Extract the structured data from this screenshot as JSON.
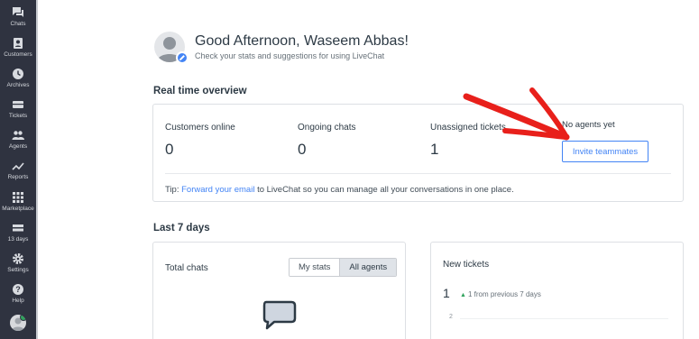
{
  "sidebar": {
    "items": [
      {
        "label": "Chats",
        "icon": "chat-icon"
      },
      {
        "label": "Customers",
        "icon": "customers-icon"
      },
      {
        "label": "Archives",
        "icon": "archives-icon"
      },
      {
        "label": "Tickets",
        "icon": "tickets-icon"
      },
      {
        "label": "Agents",
        "icon": "agents-icon"
      },
      {
        "label": "Reports",
        "icon": "reports-icon"
      },
      {
        "label": "Marketplace",
        "icon": "marketplace-icon"
      },
      {
        "label": "13 days",
        "icon": "trial-icon"
      },
      {
        "label": "Settings",
        "icon": "settings-icon"
      },
      {
        "label": "Help",
        "icon": "help-icon"
      }
    ]
  },
  "greeting": {
    "title": "Good Afternoon, Waseem Abbas!",
    "subtitle": "Check your stats and suggestions for using LiveChat"
  },
  "overview": {
    "title": "Real time overview",
    "stats": [
      {
        "label": "Customers online",
        "value": "0"
      },
      {
        "label": "Ongoing chats",
        "value": "0"
      },
      {
        "label": "Unassigned tickets",
        "value": "1"
      }
    ],
    "no_agents_text": "No agents yet",
    "invite_label": "Invite teammates",
    "tip": {
      "prefix": "Tip: ",
      "link": "Forward your email",
      "suffix": " to LiveChat so you can manage all your conversations in one place."
    }
  },
  "last7": {
    "title": "Last 7 days",
    "total_chats": {
      "heading": "Total chats",
      "tabs": [
        "My stats",
        "All agents"
      ],
      "active_tab": "All agents"
    },
    "new_tickets": {
      "heading": "New tickets",
      "value": "1",
      "trend": "1 from previous 7 days",
      "axis_tick": "2"
    }
  },
  "colors": {
    "sidebar_bg": "#2f3340",
    "accent": "#4384f5",
    "annotation": "#e8201b",
    "success": "#31a35d"
  }
}
